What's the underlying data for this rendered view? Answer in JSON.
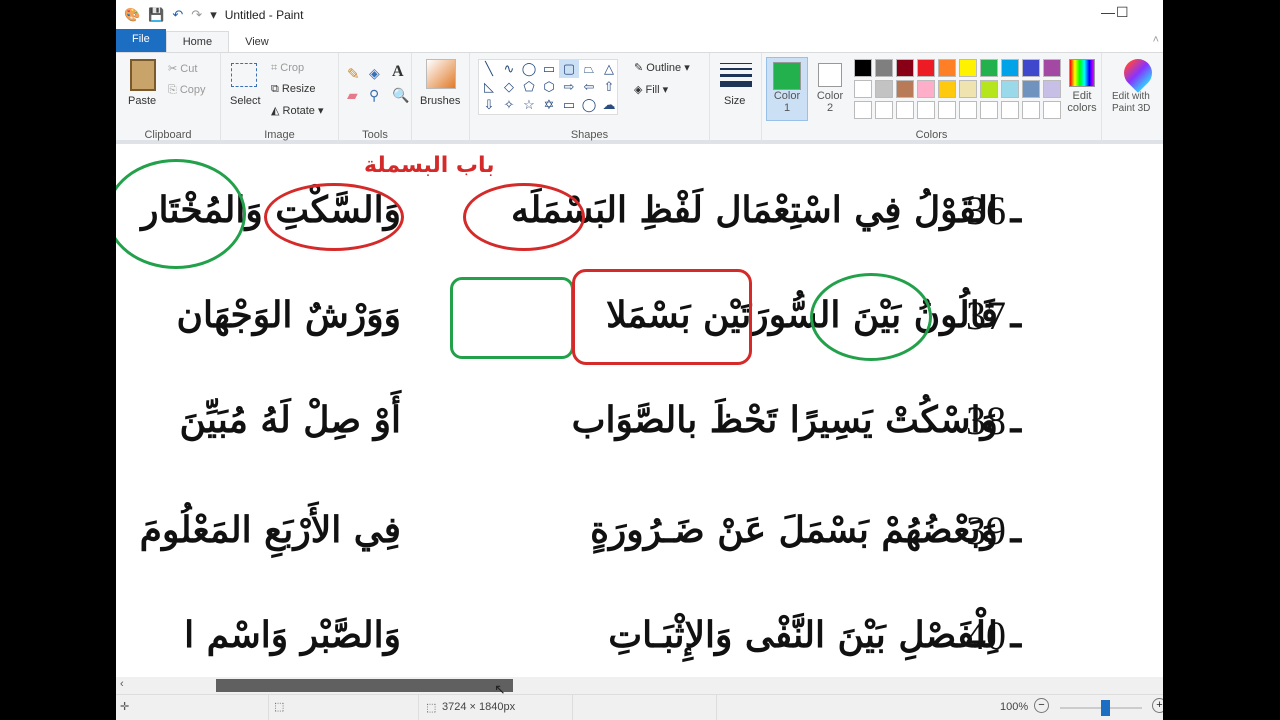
{
  "window": {
    "title": "Untitled - Paint",
    "minimize": "—",
    "maximize": "☐"
  },
  "tabs": [
    "File",
    "Home",
    "View"
  ],
  "clipboard": {
    "paste": "Paste",
    "cut": "Cut",
    "copy": "Copy",
    "label": "Clipboard"
  },
  "image": {
    "select": "Select",
    "crop": "Crop",
    "resize": "Resize",
    "rotate": "Rotate",
    "label": "Image"
  },
  "tools": {
    "label": "Tools",
    "text_tool": "A"
  },
  "brushes": {
    "label": "Brushes"
  },
  "shapes": {
    "label": "Shapes",
    "outline": "Outline",
    "fill": "Fill",
    "glyphs": [
      "╲",
      "∿",
      "◯",
      "▭",
      "▢",
      "⏢",
      "△",
      "◺",
      "◇",
      "⬠",
      "⬡",
      "⇨",
      "⇦",
      "⇧",
      "⇩",
      "✧",
      "☆",
      "✡",
      "▭",
      "◯",
      "☁"
    ]
  },
  "size": {
    "label": "Size"
  },
  "colors": {
    "label": "Colors",
    "color1": "Color",
    "color1_num": "1",
    "color2": "Color",
    "color2_num": "2",
    "edit": "Edit colors",
    "paint3d": "Edit with Paint 3D",
    "color1_value": "#22b14c",
    "color2_value": "#ffffff",
    "palette": [
      "#000000",
      "#7f7f7f",
      "#880015",
      "#ed1c24",
      "#ff7f27",
      "#fff200",
      "#22b14c",
      "#00a2e8",
      "#3f48cc",
      "#a349a4",
      "#ffffff",
      "#c3c3c3",
      "#b97a57",
      "#ffaec9",
      "#ffc90e",
      "#efe4b0",
      "#b5e61d",
      "#99d9ea",
      "#7092be",
      "#c8bfe7"
    ]
  },
  "canvas": {
    "heading": "باب البسملة",
    "lines": [
      {
        "num": "36",
        "a": "ـ القَوْلُ فِي اسْتِعْمَال لَفْظِ البَسْمَلَه",
        "b": "وَالسَّكْتِ وَالمُخْتَار"
      },
      {
        "num": "37",
        "a": "ـ قَالُونُ بَيْنَ السُّورَتَيْن بَسْمَلا",
        "b": "وَوَرْشٌ الوَجْهَان"
      },
      {
        "num": "38",
        "a": "ـ وَاسْكُتْ يَسِيرًا تَحْظَ بالصَّوَاب",
        "b": "أَوْ صِلْ لَهُ مُبَيِّنَ"
      },
      {
        "num": "39",
        "a": "ـ وَبَعْضُهُمْ بَسْمَلَ عَنْ ضَـرُورَةٍ",
        "b": "فِي الأَرْبَعِ المَعْلُومَ"
      },
      {
        "num": "40",
        "a": "ـ لِلْفَصْلِ بَيْنَ النَّفْى وَالإِثْبَـاتِ",
        "b": "وَالصَّبْر وَاسْم ا"
      }
    ]
  },
  "status": {
    "canvas_size": "3724 × 1840px",
    "zoom": "100%",
    "zoom_percent": 100
  }
}
